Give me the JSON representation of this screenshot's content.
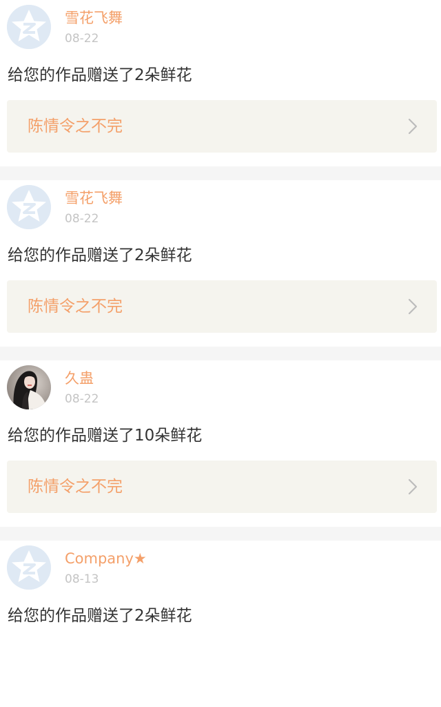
{
  "feed": {
    "items": [
      {
        "avatar_icon": "qq-zone-star-default-avatar",
        "user_name": "雪花飞舞",
        "date": "08-22",
        "message": "给您的作品赠送了2朵鲜花",
        "work_title": "陈情令之不完",
        "link_icon": "chevron-right-icon"
      },
      {
        "avatar_icon": "qq-zone-star-default-avatar",
        "user_name": "雪花飞舞",
        "date": "08-22",
        "message": "给您的作品赠送了2朵鲜花",
        "work_title": "陈情令之不完",
        "link_icon": "chevron-right-icon"
      },
      {
        "avatar_icon": "user-photo-avatar",
        "user_name": "久蛊",
        "date": "08-22",
        "message": "给您的作品赠送了10朵鲜花",
        "work_title": "陈情令之不完",
        "link_icon": "chevron-right-icon"
      },
      {
        "avatar_icon": "qq-zone-star-default-avatar",
        "user_name": "Company★",
        "date": "08-13",
        "message": "给您的作品赠送了2朵鲜花",
        "work_title": "",
        "link_icon": ""
      }
    ]
  },
  "colors": {
    "name_accent": "#f4a06a",
    "date_gray": "#c4c4c4",
    "message_text": "#333333",
    "link_box_bg": "#f5f4ee",
    "separator": "#f5f5f5",
    "default_avatar_bg": "#dfe9f4"
  }
}
